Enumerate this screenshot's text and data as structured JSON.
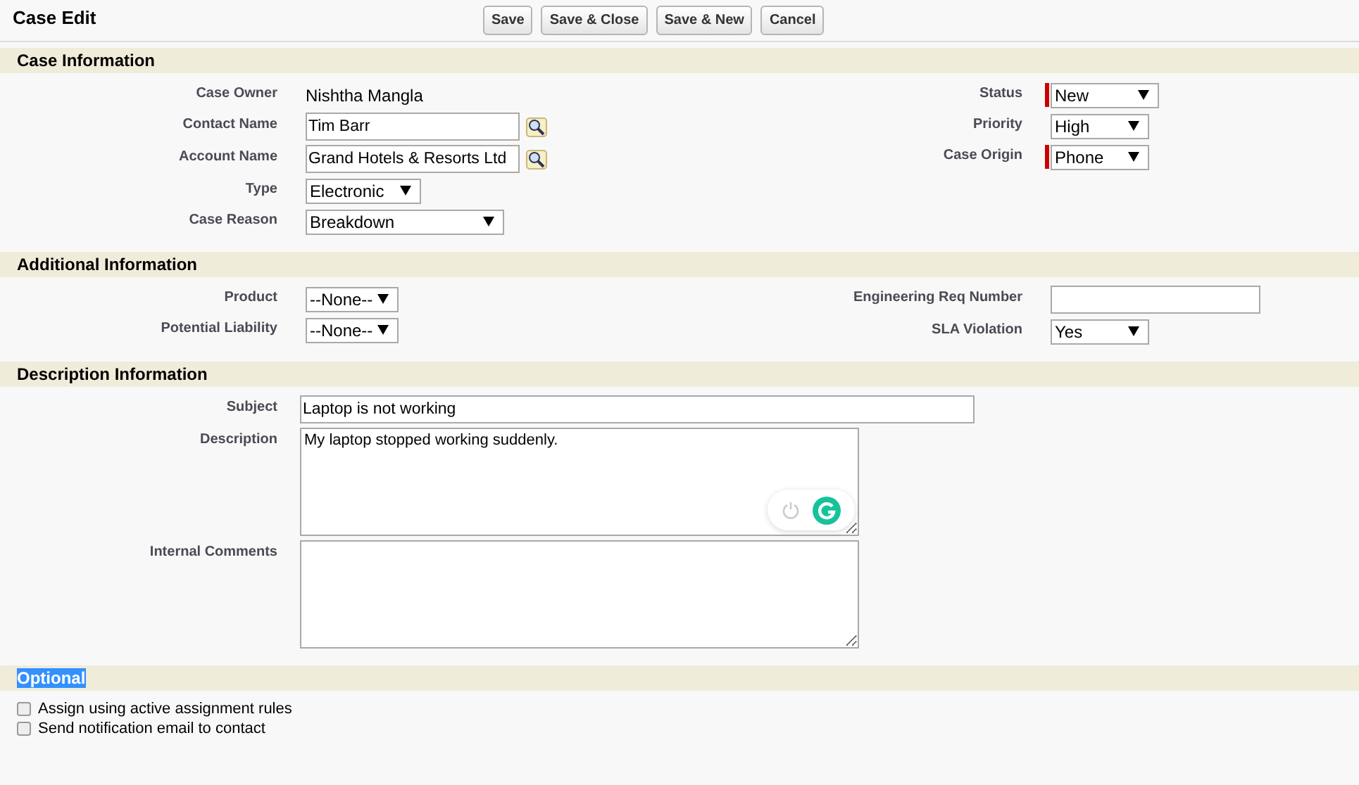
{
  "page": {
    "title": "Case Edit"
  },
  "buttons": [
    "Save",
    "Save & Close",
    "Save & New",
    "Cancel"
  ],
  "sections": [
    {
      "title": "Case Information",
      "highlighted": false,
      "kind": "two_column",
      "left": [
        {
          "label": "Case Owner",
          "kind": "static",
          "value": "Nishtha Mangla",
          "required": false
        },
        {
          "label": "Contact Name",
          "kind": "lookup",
          "value": "Tim Barr",
          "required": false
        },
        {
          "label": "Account Name",
          "kind": "lookup",
          "value": "Grand Hotels & Resorts Ltd",
          "required": false
        },
        {
          "label": "Type",
          "kind": "select",
          "value": "Electronic",
          "required": false
        },
        {
          "label": "Case Reason",
          "kind": "select",
          "value": "Breakdown",
          "required": false
        }
      ],
      "right": [
        {
          "label": "Status",
          "kind": "select",
          "value": "New",
          "required": true
        },
        {
          "label": "Priority",
          "kind": "select",
          "value": "High",
          "required": false
        },
        {
          "label": "Case Origin",
          "kind": "select",
          "value": "Phone",
          "required": true
        }
      ]
    },
    {
      "title": "Additional Information",
      "highlighted": false,
      "kind": "two_column",
      "left": [
        {
          "label": "Product",
          "kind": "select",
          "value": "--None--",
          "required": false
        },
        {
          "label": "Potential Liability",
          "kind": "select",
          "value": "--None--",
          "required": false
        }
      ],
      "right": [
        {
          "label": "Engineering Req Number",
          "kind": "input",
          "required": false
        },
        {
          "label": "SLA Violation",
          "kind": "select",
          "value": "Yes",
          "required": false
        }
      ]
    },
    {
      "title": "Description Information",
      "highlighted": false,
      "kind": "one_column",
      "fields": [
        {
          "label": "Subject",
          "kind": "input",
          "value": "Laptop is not working"
        },
        {
          "label": "Description",
          "kind": "textarea",
          "value": "My laptop stopped working suddenly.",
          "assistant": true
        },
        {
          "label": "Internal Comments",
          "kind": "textarea",
          "assistant": false
        }
      ]
    },
    {
      "title": "Optional",
      "highlighted": true,
      "kind": "checkboxes",
      "options": [
        {
          "label": "Assign using active assignment rules",
          "checked": false
        },
        {
          "label": "Send notification email to contact",
          "checked": false
        }
      ]
    }
  ]
}
